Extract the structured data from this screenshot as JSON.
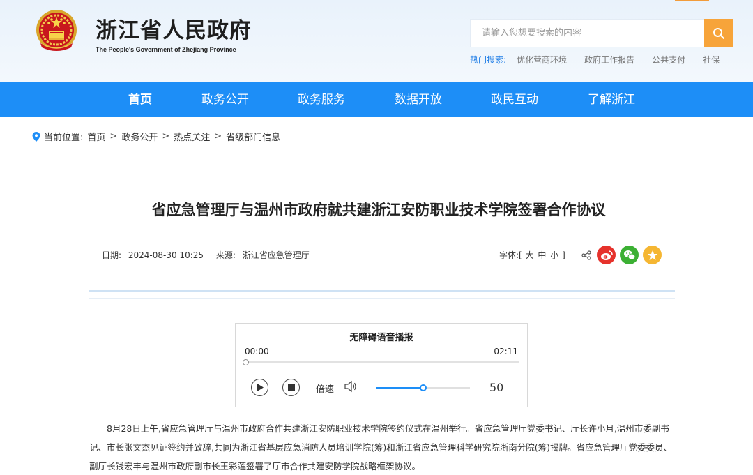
{
  "header": {
    "title": "浙江省人民政府",
    "subtitle": "The People's Government of Zhejiang Province",
    "search_placeholder": "请输入您想要搜索的内容",
    "hot_label": "热门搜索:",
    "hot_items": [
      "优化营商环境",
      "政府工作报告",
      "公共支付",
      "社保"
    ],
    "colors": {
      "accent": "#1d8ef7",
      "search_button": "#f7a43a"
    }
  },
  "nav": {
    "items": [
      "首页",
      "政务公开",
      "政务服务",
      "数据开放",
      "政民互动",
      "了解浙江"
    ],
    "active_index": 0
  },
  "breadcrumb": {
    "label": "当前位置:",
    "items": [
      "首页",
      "政务公开",
      "热点关注",
      "省级部门信息"
    ],
    "separator": ">"
  },
  "article": {
    "title": "省应急管理厅与温州市政府就共建浙江安防职业技术学院签署合作协议",
    "date_label": "日期:",
    "date": "2024-08-30 10:25",
    "source_label": "来源:",
    "source": "浙江省应急管理厅",
    "font_label": "字体:[",
    "font_sizes": [
      "大",
      "中",
      "小"
    ],
    "font_end": "]",
    "share_icons": [
      "share-icon",
      "weibo-icon",
      "wechat-icon",
      "favorite-icon"
    ],
    "body": "8月28日上午,省应急管理厅与温州市政府合作共建浙江安防职业技术学院签约仪式在温州举行。省应急管理厅党委书记、厅长许小月,温州市委副书记、市长张文杰见证签约并致辞,共同为浙江省基层应急消防人员培训学院(筹)和浙江省应急管理科学研究院浙南分院(筹)揭牌。省应急管理厅党委委员、副厅长钱宏丰与温州市政府副市长王彩莲签署了厅市合作共建安防学院战略框架协议。"
  },
  "player": {
    "title": "无障碍语音播报",
    "current_time": "00:00",
    "total_time": "02:11",
    "progress": 0,
    "speed_label": "倍速",
    "volume": 50
  }
}
